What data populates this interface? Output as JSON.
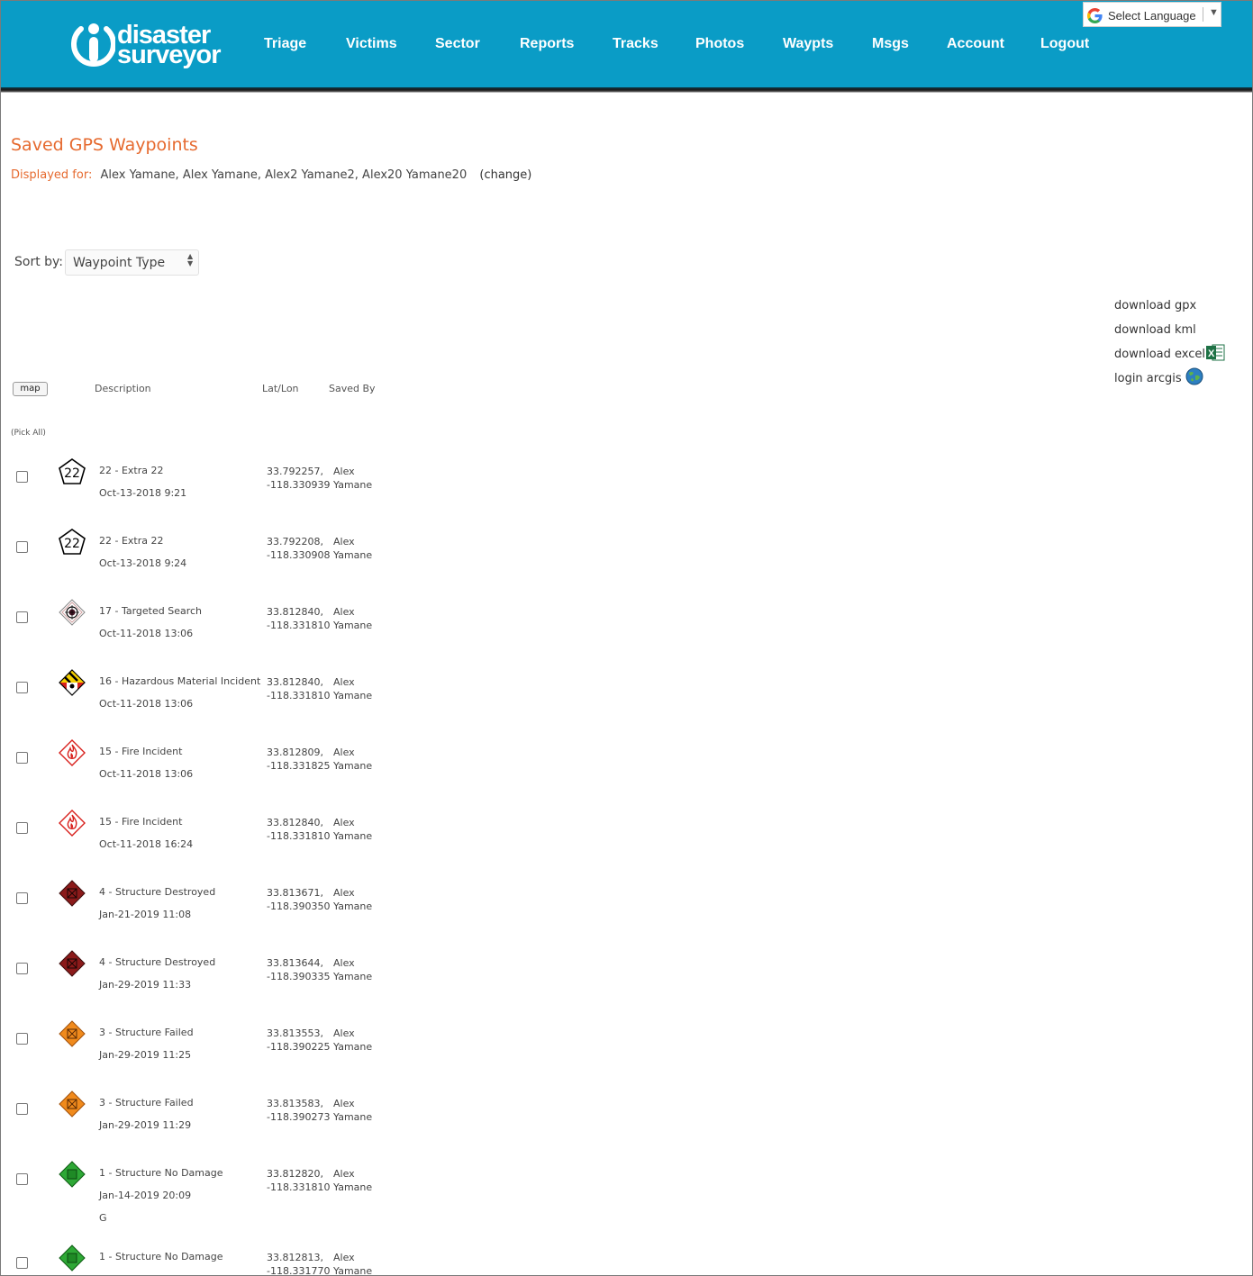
{
  "header": {
    "logo_line1": "disaster",
    "logo_line2": "surveyor",
    "nav": [
      "Triage",
      "Victims",
      "Sector",
      "Reports",
      "Tracks",
      "Photos",
      "Waypts",
      "Msgs",
      "Account",
      "Logout"
    ],
    "language": "Select Language",
    "colors": {
      "header_bg": "#0a9cc6",
      "accent": "#e66a2f"
    }
  },
  "page": {
    "title": "Saved GPS Waypoints",
    "displayed_label": "Displayed for:",
    "displayed_names": "Alex Yamane, Alex Yamane, Alex2 Yamane2, Alex20 Yamane20",
    "change_link": "(change)",
    "sort_label": "Sort by:",
    "sort_value": "Waypoint Type"
  },
  "downloads": {
    "gpx": "download gpx",
    "kml": "download kml",
    "excel": "download excel",
    "arcgis": "login arcgis"
  },
  "table": {
    "map_button": "map",
    "headers": {
      "description": "Description",
      "latlon": "Lat/Lon",
      "saved_by": "Saved By"
    },
    "pick_all": "(Pick All)",
    "rows": [
      {
        "icon": "pentagon-22-icon",
        "desc": "22 - Extra 22",
        "date": "Oct-13-2018 9:21",
        "lat": "33.792257,",
        "lon": "-118.330939",
        "by1": "Alex",
        "by2": "Yamane",
        "note": ""
      },
      {
        "icon": "pentagon-22-icon",
        "desc": "22 - Extra 22",
        "date": "Oct-13-2018 9:24",
        "lat": "33.792208,",
        "lon": "-118.330908",
        "by1": "Alex",
        "by2": "Yamane",
        "note": ""
      },
      {
        "icon": "targeted-search-icon",
        "desc": "17 - Targeted Search",
        "date": "Oct-11-2018 13:06",
        "lat": "33.812840,",
        "lon": "-118.331810",
        "by1": "Alex",
        "by2": "Yamane",
        "note": ""
      },
      {
        "icon": "hazmat-icon",
        "desc": "16 - Hazardous Material Incident",
        "date": "Oct-11-2018 13:06",
        "lat": "33.812840,",
        "lon": "-118.331810",
        "by1": "Alex",
        "by2": "Yamane",
        "note": ""
      },
      {
        "icon": "fire-icon",
        "desc": "15 - Fire Incident",
        "date": "Oct-11-2018 13:06",
        "lat": "33.812809,",
        "lon": "-118.331825",
        "by1": "Alex",
        "by2": "Yamane",
        "note": ""
      },
      {
        "icon": "fire-icon",
        "desc": "15 - Fire Incident",
        "date": "Oct-11-2018 16:24",
        "lat": "33.812840,",
        "lon": "-118.331810",
        "by1": "Alex",
        "by2": "Yamane",
        "note": ""
      },
      {
        "icon": "structure-destroyed-icon",
        "desc": "4 - Structure Destroyed",
        "date": "Jan-21-2019 11:08",
        "lat": "33.813671,",
        "lon": "-118.390350",
        "by1": "Alex",
        "by2": "Yamane",
        "note": ""
      },
      {
        "icon": "structure-destroyed-icon",
        "desc": "4 - Structure Destroyed",
        "date": "Jan-29-2019 11:33",
        "lat": "33.813644,",
        "lon": "-118.390335",
        "by1": "Alex",
        "by2": "Yamane",
        "note": ""
      },
      {
        "icon": "structure-failed-icon",
        "desc": "3 - Structure Failed",
        "date": "Jan-29-2019 11:25",
        "lat": "33.813553,",
        "lon": "-118.390225",
        "by1": "Alex",
        "by2": "Yamane",
        "note": ""
      },
      {
        "icon": "structure-failed-icon",
        "desc": "3 - Structure Failed",
        "date": "Jan-29-2019 11:29",
        "lat": "33.813583,",
        "lon": "-118.390273",
        "by1": "Alex",
        "by2": "Yamane",
        "note": ""
      },
      {
        "icon": "structure-no-damage-icon",
        "desc": "1 - Structure No Damage",
        "date": "Jan-14-2019 20:09",
        "lat": "33.812820,",
        "lon": "-118.331810",
        "by1": "Alex",
        "by2": "Yamane",
        "note": "G"
      },
      {
        "icon": "structure-no-damage-icon",
        "desc": "1 - Structure No Damage",
        "date": "",
        "lat": "33.812813,",
        "lon": "-118.331770",
        "by1": "Alex",
        "by2": "Yamane",
        "note": ""
      }
    ]
  }
}
